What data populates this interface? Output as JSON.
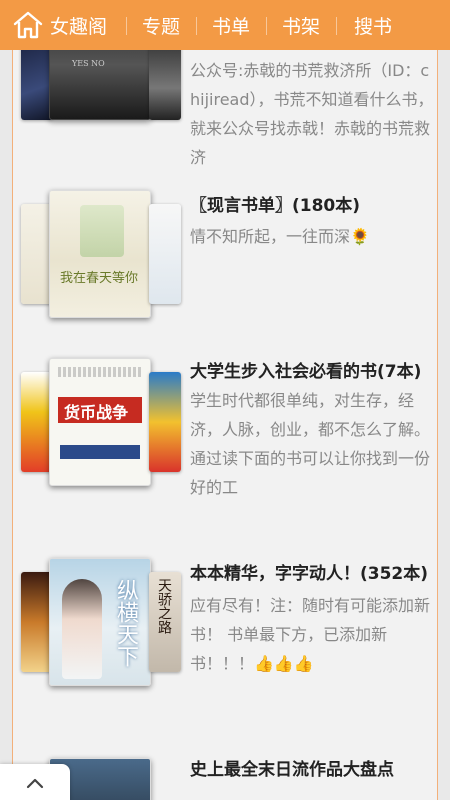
{
  "nav": {
    "home_label": "女趣阁",
    "items": [
      "专题",
      "书单",
      "书架",
      "搜书"
    ],
    "bg_color": "#f39a45"
  },
  "lists": [
    {
      "title": "",
      "desc": "公众号:赤戟的书荒救济所（ID：chijiread），书荒不知道看什么书，就来公众号找赤戟！赤戟的书荒救济",
      "covers": [
        "dark",
        "YES NO",
        "dark-title"
      ]
    },
    {
      "title": "〖现言书单〗(180本)",
      "desc": "情不知所起，一往而深🌻",
      "cover_title": "我在春天等你"
    },
    {
      "title": "大学生步入社会必看的书(7本)",
      "desc": "学生时代都很单纯，对生存，经济，人脉，创业，都不怎么了解。通过读下面的书可以让你找到一份好的工",
      "cover_title": "货币战争"
    },
    {
      "title": "本本精华，字字动人！(352本)",
      "desc": "应有尽有！注：随时有可能添加新书！ 书单最下方，已添加新书！！！👍👍👍",
      "cover_title": "纵横天下",
      "side_title": "天骄之路"
    },
    {
      "title": "史上最全末日流作品大盘点",
      "desc": ""
    }
  ],
  "back_to_top": "chevron-up-icon"
}
